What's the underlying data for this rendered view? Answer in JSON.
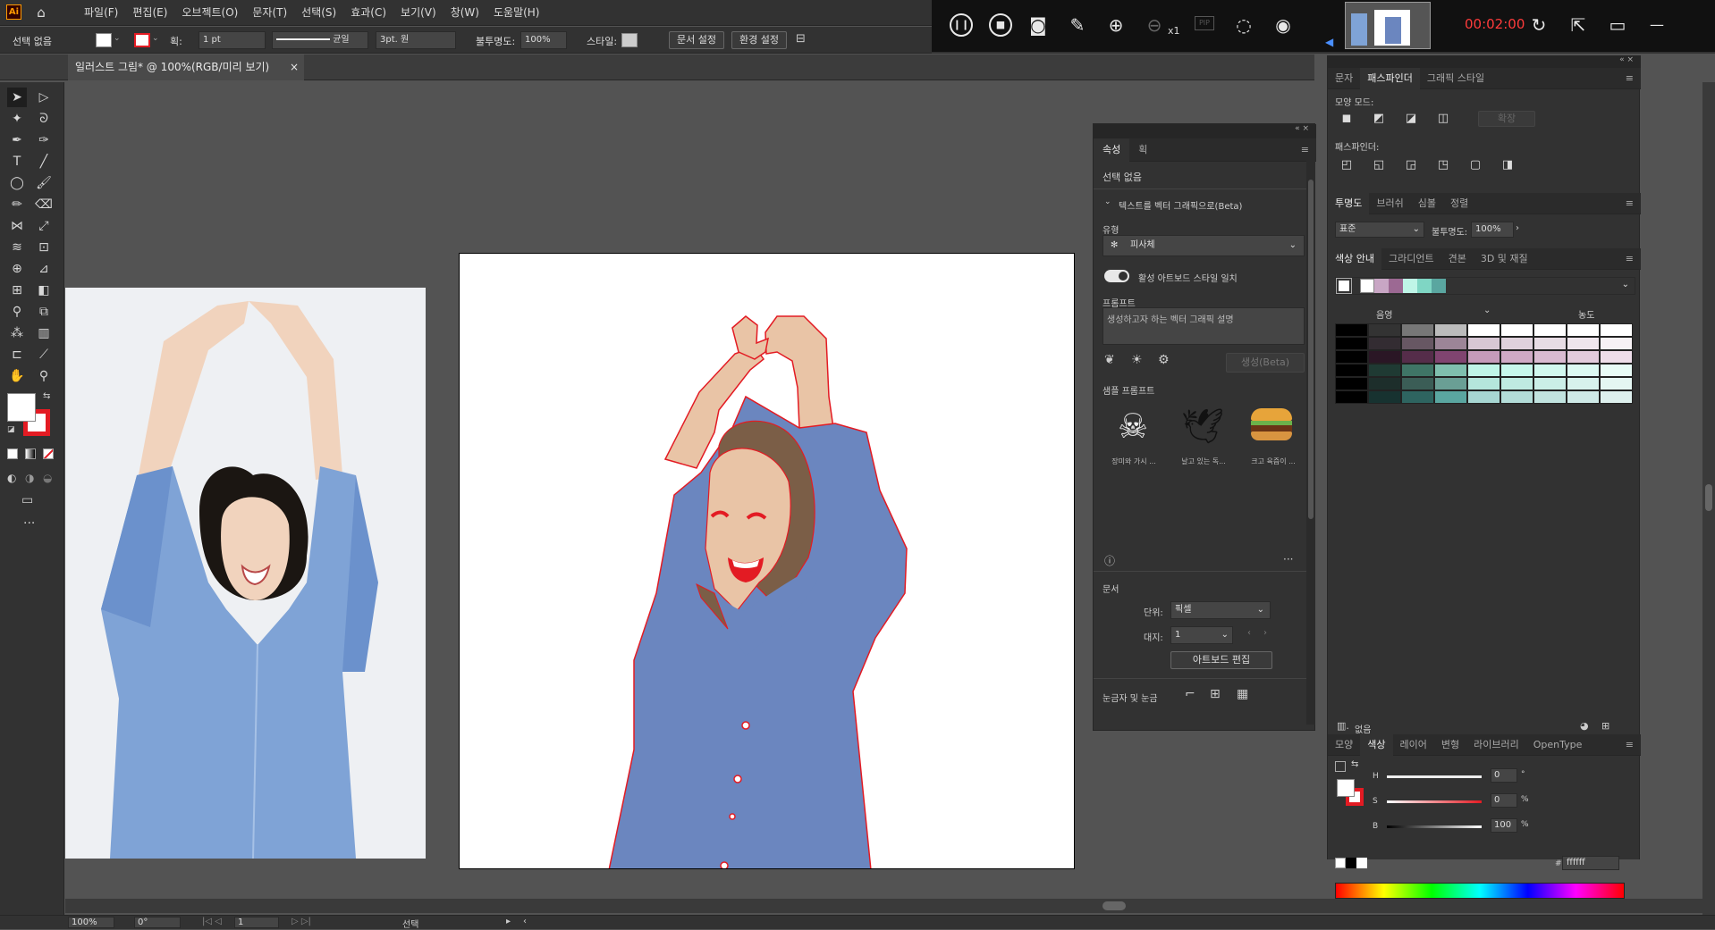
{
  "app": {
    "logo": "Ai",
    "menus": [
      "파일(F)",
      "편집(E)",
      "오브젝트(O)",
      "문자(T)",
      "선택(S)",
      "효과(C)",
      "보기(V)",
      "창(W)",
      "도움말(H)"
    ]
  },
  "recorder": {
    "time": "00:02:00",
    "zoom_label": "x1"
  },
  "control": {
    "selection": "선택 없음",
    "stroke_label": "획:",
    "stroke_width": "1 pt",
    "stroke_style": "균일",
    "brush": "3pt. 원",
    "opacity_label": "불투명도:",
    "opacity": "100%",
    "style_label": "스타일:",
    "doc_setup": "문서 설정",
    "prefs": "환경 설정"
  },
  "document": {
    "tab_title": "일러스트 그림* @ 100%(RGB/미리 보기)",
    "close": "×"
  },
  "status": {
    "zoom": "100%",
    "rotate": "0°",
    "artboard": "1",
    "tool": "선택"
  },
  "properties": {
    "tabs": [
      "속성",
      "획"
    ],
    "no_selection": "선택 없음",
    "section_vector": "텍스트를 벡터 그래픽으로(Beta)",
    "type_label": "유형",
    "type_value": "피사체",
    "toggle_label": "활성 아트보드 스타일 일치",
    "prompt_label": "프롬프트",
    "prompt_placeholder": "생성하고자 하는 벡터 그래픽 설명",
    "generate": "생성(Beta)",
    "samples_label": "샘플 프롬프트",
    "samples": [
      "장미와 가시 ...",
      "날고 있는 독...",
      "크고 육즙이 ..."
    ],
    "doc_label": "문서",
    "unit_label": "단위:",
    "unit_value": "픽셀",
    "artboard_label": "대지:",
    "artboard_value": "1",
    "edit_artboard": "아트보드 편집",
    "rulers_label": "눈금자 및 눈금"
  },
  "right": {
    "top_tabs": [
      "문자",
      "패스파인더",
      "그래픽 스타일"
    ],
    "shape_modes": "모양 모드:",
    "expand": "확장",
    "pathfinders": "패스파인더:",
    "transparency_tabs": [
      "투명도",
      "브러쉬",
      "심볼",
      "정렬"
    ],
    "blend": "표준",
    "opacity_label": "불투명도:",
    "opacity": "100%",
    "guide_tabs": [
      "색상 안내",
      "그라디언트",
      "견본",
      "3D 및 재질"
    ],
    "shades": "음영",
    "tints": "농도",
    "none_label": "없음",
    "color_tabs": [
      "모양",
      "색상",
      "레이어",
      "변형",
      "라이브러리",
      "OpenType"
    ],
    "h_label": "H",
    "s_label": "S",
    "b_label": "B",
    "h_val": "0",
    "s_val": "0",
    "b_val": "100",
    "deg": "°",
    "pct": "%",
    "hash": "#",
    "hex": "ffffff"
  },
  "colors": {
    "accent_red": "#e31b23",
    "shirt": "#6b86bf",
    "skin": "#e9c4a6",
    "hair": "#7b5e47"
  }
}
